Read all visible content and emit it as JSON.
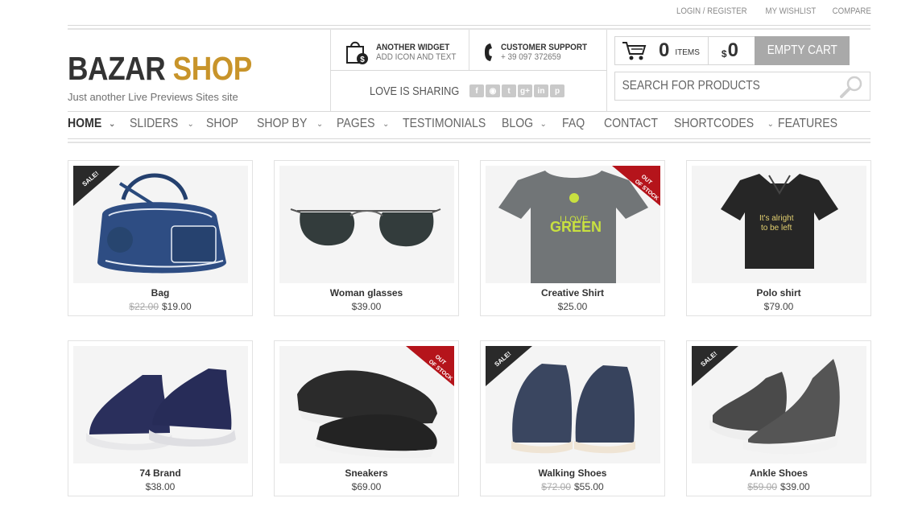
{
  "toplinks": [
    "LOGIN / REGISTER",
    "MY WISHLIST",
    "COMPARE"
  ],
  "logo": {
    "part1": "BAZAR ",
    "part2": "SHOP",
    "tagline": "Just another Live Previews Sites site"
  },
  "widget": {
    "title": "ANOTHER WIDGET",
    "sub": "ADD ICON AND TEXT"
  },
  "support": {
    "title": "CUSTOMER SUPPORT",
    "phone": "+ 39 097 372659"
  },
  "sharing": {
    "label": "LOVE IS SHARING",
    "icons": [
      "f",
      "rss",
      "twitter",
      "g+",
      "in",
      "p"
    ]
  },
  "cart": {
    "count": "0",
    "items_label": "ITEMS",
    "currency": "$",
    "total": "0",
    "empty_label": "EMPTY CART"
  },
  "search": {
    "placeholder": "SEARCH FOR PRODUCTS"
  },
  "nav": [
    {
      "label": "HOME",
      "dropdown": true
    },
    {
      "label": "SLIDERS",
      "dropdown": true
    },
    {
      "label": "SHOP",
      "dropdown": false
    },
    {
      "label": "SHOP BY",
      "dropdown": true
    },
    {
      "label": "PAGES",
      "dropdown": true
    },
    {
      "label": "TESTIMONIALS",
      "dropdown": false
    },
    {
      "label": "BLOG",
      "dropdown": true
    },
    {
      "label": "FAQ",
      "dropdown": false
    },
    {
      "label": "CONTACT",
      "dropdown": false
    },
    {
      "label": "SHORTCODES",
      "dropdown": true
    },
    {
      "label": "FEATURES",
      "dropdown": false
    }
  ],
  "ribbons": {
    "sale": "SALE!",
    "out": "OUT OF STOCK"
  },
  "products": [
    {
      "name": "Bag",
      "old_price": "$22.00",
      "price": "$19.00",
      "badge": "sale",
      "image": "bag"
    },
    {
      "name": "Woman glasses",
      "old_price": "",
      "price": "$39.00",
      "badge": "",
      "image": "glasses"
    },
    {
      "name": "Creative Shirt",
      "old_price": "",
      "price": "$25.00",
      "badge": "out",
      "image": "tshirt",
      "shirt_text1": "I LOVE",
      "shirt_text2": "GREEN"
    },
    {
      "name": "Polo shirt",
      "old_price": "",
      "price": "$79.00",
      "badge": "",
      "image": "polo",
      "shirt_text1": "It's alright",
      "shirt_text2": "to be left"
    },
    {
      "name": "74 Brand",
      "old_price": "",
      "price": "$38.00",
      "badge": "",
      "image": "shoes-blue"
    },
    {
      "name": "Sneakers",
      "old_price": "",
      "price": "$69.00",
      "badge": "out",
      "image": "sneakers"
    },
    {
      "name": "Walking Shoes",
      "old_price": "$72.00",
      "price": "$55.00",
      "badge": "sale",
      "image": "walking"
    },
    {
      "name": "Ankle Shoes",
      "old_price": "$59.00",
      "price": "$39.00",
      "badge": "sale",
      "image": "ankle"
    }
  ],
  "colors": {
    "brand_gold": "#c8942a",
    "text_dark": "#333333",
    "sale_ribbon": "#2a2a2a",
    "out_ribbon": "#b5141b",
    "button_gray": "#a9a9a9"
  }
}
